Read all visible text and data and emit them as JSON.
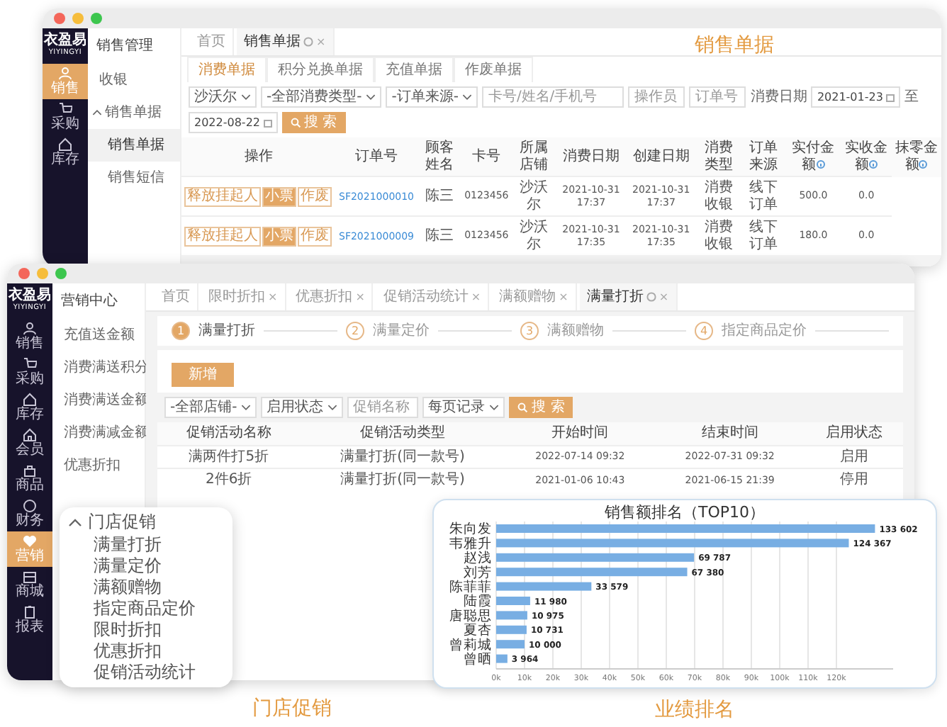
{
  "captions": [
    {
      "kind": "sales",
      "text": "销售单据"
    },
    {
      "kind": "promo",
      "text": "门店促销"
    },
    {
      "kind": "rank",
      "text": "业绩排名"
    }
  ],
  "sales_window": {
    "sidebar": {
      "logo": "衣盈易",
      "logo_sub": "YIYINGYI",
      "items": [
        {
          "label": "销售",
          "selected": true
        },
        {
          "label": "采购",
          "selected": false
        },
        {
          "label": "库存",
          "selected": false
        }
      ]
    },
    "menu": {
      "title": "销售管理",
      "items": [
        {
          "kind": "item",
          "label": "收银",
          "selected": false
        },
        {
          "kind": "group",
          "label": "销售单据",
          "expanded": true,
          "children": [
            {
              "label": "销售单据",
              "selected": true
            },
            {
              "label": "销售短信",
              "selected": false
            }
          ]
        }
      ]
    },
    "tabs": [
      {
        "label": "首页",
        "selected": false
      },
      {
        "label": "销售单据",
        "selected": true,
        "close": "×"
      }
    ],
    "subtabs": [
      {
        "label": "消费单据",
        "selected": true
      },
      {
        "label": "积分兑换单据",
        "selected": false
      },
      {
        "label": "充值单据",
        "selected": false
      },
      {
        "label": "作废单据",
        "selected": false
      }
    ],
    "filters": [
      {
        "kind": "select",
        "value": "沙沃尔"
      },
      {
        "kind": "select",
        "value": "-全部消费类型-"
      },
      {
        "kind": "select",
        "value": "-订单来源-"
      },
      {
        "kind": "input",
        "placeholder": "卡号/姓名/手机号"
      },
      {
        "kind": "input",
        "placeholder": "操作员"
      },
      {
        "kind": "input",
        "placeholder": "订单号"
      },
      {
        "kind": "label",
        "text": "消费日期"
      },
      {
        "kind": "date",
        "value": "2021-01-23"
      },
      {
        "kind": "label",
        "text": "至"
      },
      {
        "kind": "date",
        "value": "2022-08-22"
      },
      {
        "kind": "button",
        "label": "搜 索"
      }
    ],
    "table": {
      "columns": [
        {
          "label": "操作"
        },
        {
          "label": "订单号"
        },
        {
          "label": "顾客姓名"
        },
        {
          "label": "卡号"
        },
        {
          "label": "所属店铺"
        },
        {
          "label": "消费日期"
        },
        {
          "label": "创建日期"
        },
        {
          "label": "消费类型"
        },
        {
          "label": "订单来源"
        },
        {
          "label": "实付金额",
          "info": true
        },
        {
          "label": "实收金额",
          "info": true
        },
        {
          "label": "抹零金额",
          "info": true
        }
      ],
      "rows": [
        {
          "cells": [
            {
              "kind": "actions",
              "actions": [
                "释放挂起人",
                "小票",
                "作废"
              ]
            },
            {
              "kind": "link",
              "text": "SF2021000010"
            },
            {
              "kind": "text",
              "text": "陈三"
            },
            {
              "kind": "text",
              "text": "0123456"
            },
            {
              "kind": "text",
              "text": "沙沃尔"
            },
            {
              "kind": "text",
              "text": "2021-10-31 17:37"
            },
            {
              "kind": "text",
              "text": "2021-10-31 17:37"
            },
            {
              "kind": "text",
              "text": "消费收银"
            },
            {
              "kind": "text",
              "text": "线下订单"
            },
            {
              "kind": "text",
              "text": "500.0"
            },
            {
              "kind": "text",
              "text": "0.0"
            }
          ]
        },
        {
          "cells": [
            {
              "kind": "actions",
              "actions": [
                "释放挂起人",
                "小票",
                "作废"
              ]
            },
            {
              "kind": "link",
              "text": "SF2021000009"
            },
            {
              "kind": "text",
              "text": "陈三"
            },
            {
              "kind": "text",
              "text": "0123456"
            },
            {
              "kind": "text",
              "text": "沙沃尔"
            },
            {
              "kind": "text",
              "text": "2021-10-31 17:35"
            },
            {
              "kind": "text",
              "text": "2021-10-31 17:35"
            },
            {
              "kind": "text",
              "text": "消费收银"
            },
            {
              "kind": "text",
              "text": "线下订单"
            },
            {
              "kind": "text",
              "text": "180.0"
            },
            {
              "kind": "text",
              "text": "0.0"
            }
          ]
        }
      ]
    }
  },
  "promo_window": {
    "sidebar": {
      "logo": "衣盈易",
      "logo_sub": "YIYINGYI",
      "items": [
        {
          "label": "销售",
          "selected": false
        },
        {
          "label": "采购",
          "selected": false
        },
        {
          "label": "库存",
          "selected": false
        },
        {
          "label": "会员",
          "selected": false
        },
        {
          "label": "商品",
          "selected": false
        },
        {
          "label": "财务",
          "selected": false
        },
        {
          "label": "营销",
          "selected": true
        },
        {
          "label": "商城",
          "selected": false
        },
        {
          "label": "报表",
          "selected": false
        }
      ]
    },
    "menu": {
      "title": "营销中心",
      "items": [
        {
          "kind": "item",
          "label": "充值送金额",
          "selected": false
        },
        {
          "kind": "item",
          "label": "消费满送积分",
          "selected": false
        },
        {
          "kind": "item",
          "label": "消费满送金额",
          "selected": false
        },
        {
          "kind": "item",
          "label": "消费满减金额",
          "selected": false
        },
        {
          "kind": "item",
          "label": "优惠折扣",
          "selected": false
        }
      ]
    },
    "tabs": [
      {
        "label": "首页",
        "selected": false
      },
      {
        "label": "限时折扣",
        "selected": false,
        "close": "×"
      },
      {
        "label": "优惠折扣",
        "selected": false,
        "close": "×"
      },
      {
        "label": "促销活动统计",
        "selected": false,
        "close": "×"
      },
      {
        "label": "满额赠物",
        "selected": false,
        "close": "×"
      },
      {
        "label": "满量打折",
        "selected": true,
        "close": "×"
      }
    ],
    "steps": [
      {
        "number": "1",
        "label": "满量打折",
        "selected": true
      },
      {
        "number": "2",
        "label": "满量定价",
        "selected": false
      },
      {
        "number": "3",
        "label": "满额赠物",
        "selected": false
      },
      {
        "number": "4",
        "label": "指定商品定价",
        "selected": false
      }
    ],
    "add_button": "新增",
    "filters": [
      {
        "kind": "select",
        "value": "-全部店铺-"
      },
      {
        "kind": "select",
        "value": "启用状态"
      },
      {
        "kind": "input",
        "placeholder": "促销名称"
      },
      {
        "kind": "select",
        "value": "每页记录"
      },
      {
        "kind": "button",
        "label": "搜 索"
      }
    ],
    "table": {
      "columns": [
        {
          "label": "促销活动名称"
        },
        {
          "label": "促销活动类型"
        },
        {
          "label": "开始时间"
        },
        {
          "label": "结束时间"
        },
        {
          "label": "启用状态"
        }
      ],
      "rows": [
        {
          "cells": [
            "满两件打5折",
            "满量打折(同一款号)",
            "2022-07-14 09:32",
            "2022-07-31 09:32",
            "启用"
          ]
        },
        {
          "cells": [
            "2件6折",
            "满量打折(同一款号)",
            "2021-01-06 10:43",
            "2021-06-15 21:39",
            "停用"
          ]
        }
      ]
    }
  },
  "promo_menu": {
    "title": "门店促销",
    "expanded": true,
    "items": [
      "满量打折",
      "满量定价",
      "满额赠物",
      "指定商品定价",
      "限时折扣",
      "优惠折扣",
      "促销活动统计"
    ]
  },
  "sales_chart": {
    "title": "销售额排名（TOP10）",
    "chart_data": {
      "type": "bar",
      "orientation": "horizontal",
      "categories": [
        "朱向发",
        "韦雅升",
        "赵浅",
        "刘芳",
        "陈菲菲",
        "陆霞",
        "唐聪思",
        "夏杏",
        "曾莉城",
        "曾晒"
      ],
      "values": [
        133602,
        124367,
        69787,
        67380,
        33579,
        11980,
        10975,
        10731,
        10000,
        3964
      ],
      "data_labels": true,
      "grid": true,
      "xlim": [
        0,
        140000
      ],
      "xticks": [
        {
          "value": 0,
          "label": "0k"
        },
        {
          "value": 10000,
          "label": "10k"
        },
        {
          "value": 20000,
          "label": "20k"
        },
        {
          "value": 30000,
          "label": "30k"
        },
        {
          "value": 40000,
          "label": "40k"
        },
        {
          "value": 50000,
          "label": "50k"
        },
        {
          "value": 60000,
          "label": "60k"
        },
        {
          "value": 70000,
          "label": "70k"
        },
        {
          "value": 80000,
          "label": "80k"
        },
        {
          "value": 90000,
          "label": "90k"
        },
        {
          "value": 100000,
          "label": "100k"
        },
        {
          "value": 110000,
          "label": "110k"
        },
        {
          "value": 120000,
          "label": "120k"
        }
      ]
    }
  }
}
